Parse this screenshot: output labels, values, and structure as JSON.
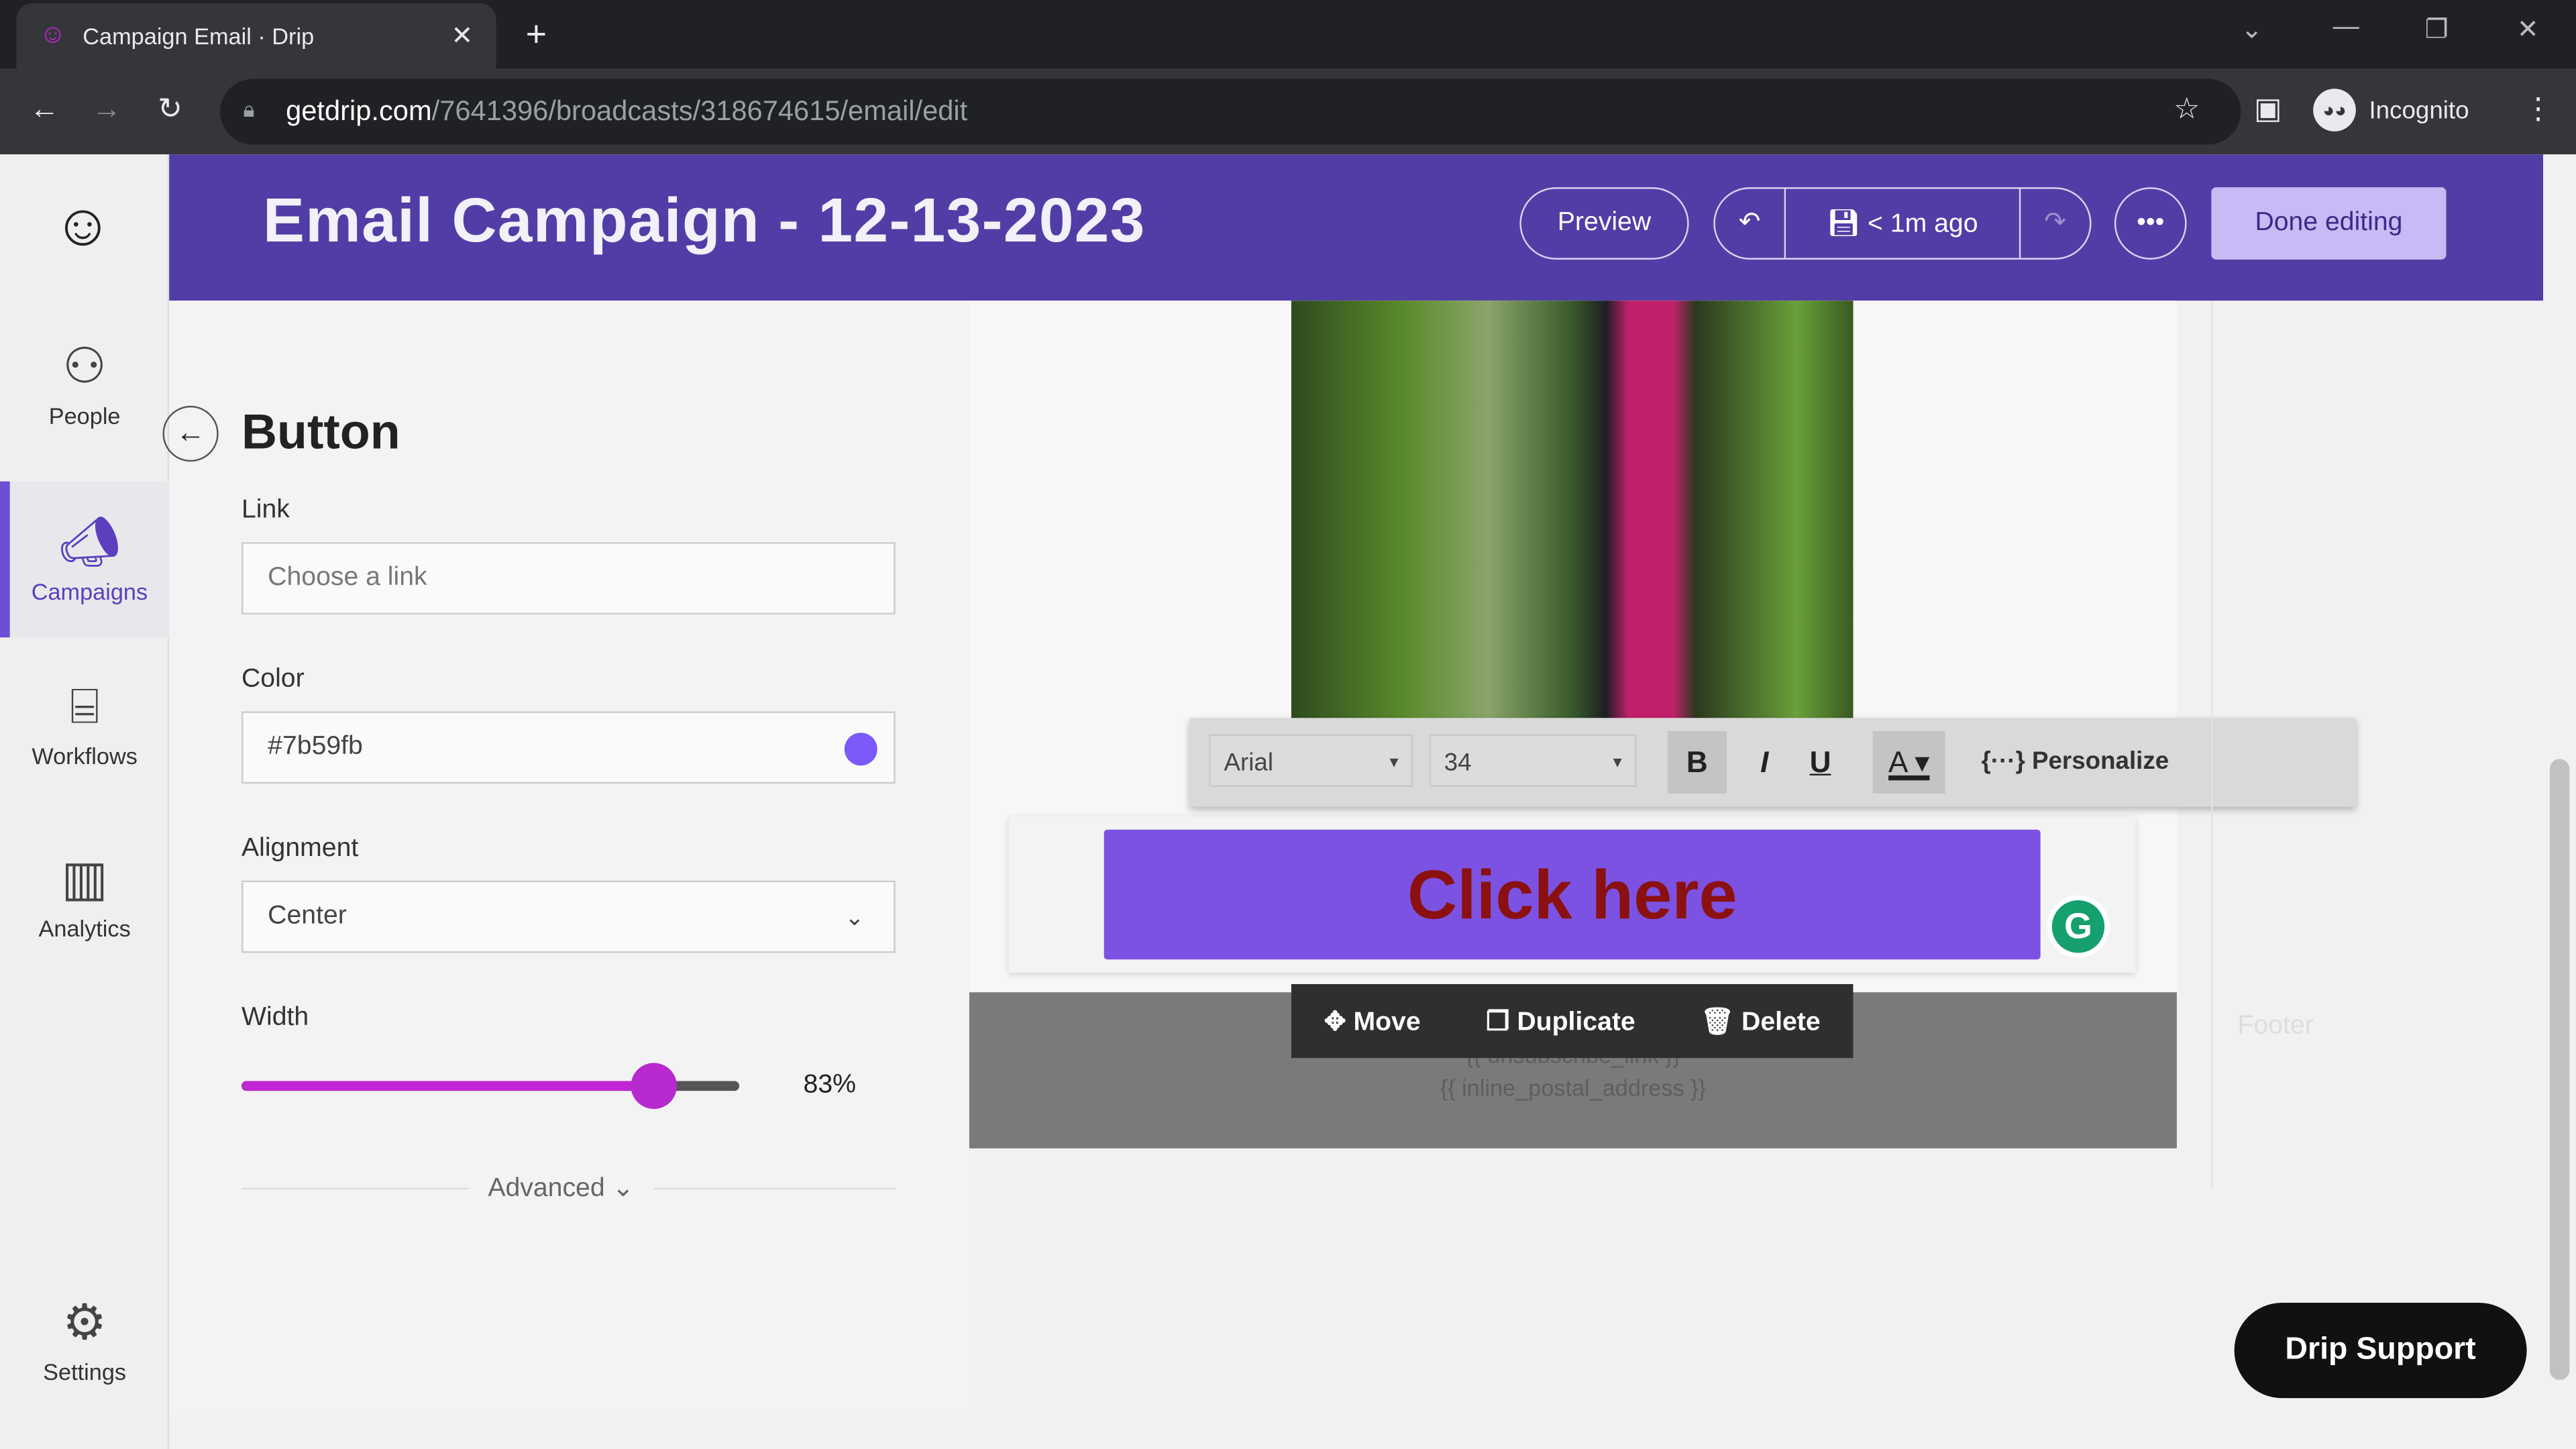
{
  "browser": {
    "tab_title": "Campaign Email · Drip",
    "url_host": "getdrip.com",
    "url_path": "/7641396/broadcasts/318674615/email/edit",
    "profile": "Incognito"
  },
  "sidebar": {
    "items": [
      {
        "label": "People",
        "icon": "people-icon"
      },
      {
        "label": "Campaigns",
        "icon": "megaphone-icon",
        "active": true
      },
      {
        "label": "Workflows",
        "icon": "workflow-icon"
      },
      {
        "label": "Analytics",
        "icon": "bar-chart-icon"
      },
      {
        "label": "Settings",
        "icon": "gear-icon"
      }
    ]
  },
  "header": {
    "title": "Email Campaign - 12-13-2023",
    "preview": "Preview",
    "saved": "< 1m ago",
    "done": "Done editing"
  },
  "panel": {
    "title": "Button",
    "link_label": "Link",
    "link_placeholder": "Choose a link",
    "color_label": "Color",
    "color_value": "#7b59fb",
    "alignment_label": "Alignment",
    "alignment_value": "Center",
    "width_label": "Width",
    "width_value": "83%",
    "width_percent": 83,
    "advanced": "Advanced"
  },
  "toolbar": {
    "font": "Arial",
    "size": "34",
    "bold": "B",
    "italic": "I",
    "underline": "U",
    "color": "A",
    "personalize": "Personalize"
  },
  "email": {
    "button_text": "Click here",
    "button_color": "#7b59fb",
    "text_color": "#8b1010",
    "footer_line1": "{{ unsubscribe_link }}",
    "footer_line2": "{{ inline_postal_address }}",
    "footer_label": "Footer"
  },
  "block_actions": {
    "move": "Move",
    "duplicate": "Duplicate",
    "delete": "Delete"
  },
  "support": "Drip Support",
  "colors": {
    "brand": "#523da6",
    "accent": "#7b59fb",
    "slider": "#c026d3"
  }
}
